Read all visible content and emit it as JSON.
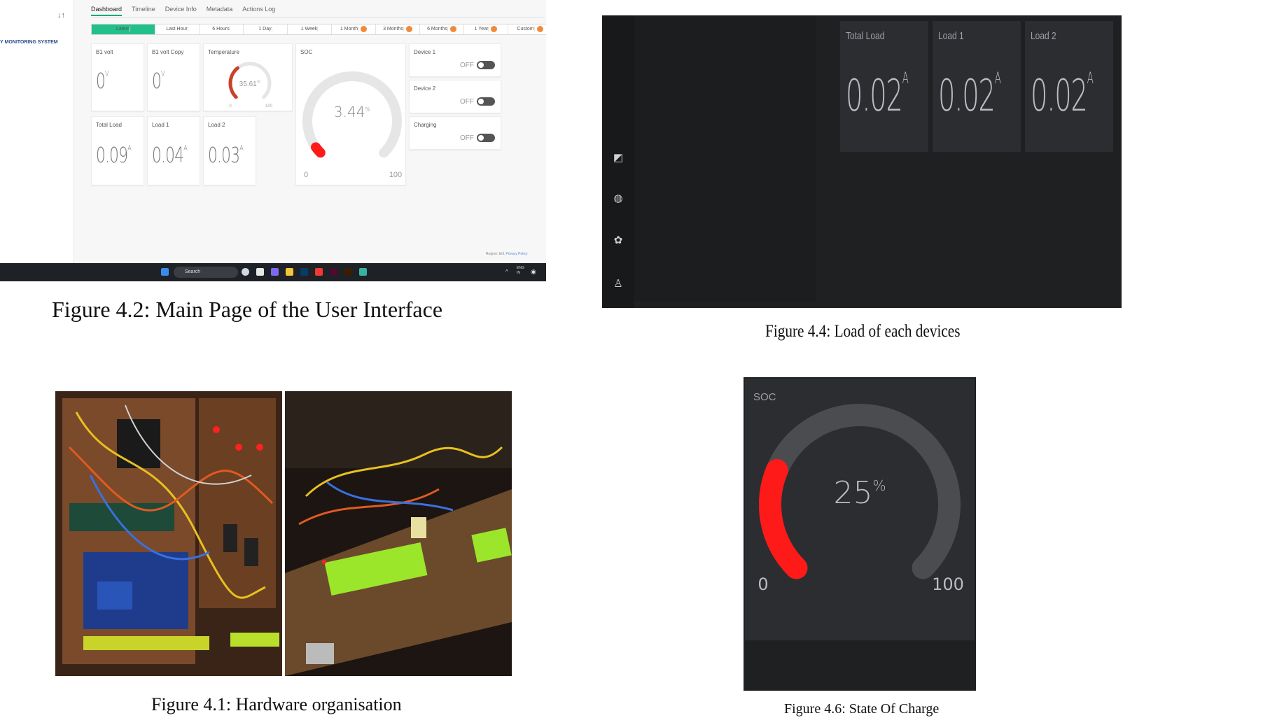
{
  "fig42": {
    "brand": "Y MONITORING SYSTEM",
    "tabs": [
      "Dashboard",
      "Timeline",
      "Device Info",
      "Metadata",
      "Actions Log"
    ],
    "ranges": [
      "Latest",
      "Last Hour",
      "6 Hours",
      "1 Day",
      "1 Week",
      "1 Month",
      "3 Months",
      "6 Months",
      "1 Year",
      "Custom"
    ],
    "widgets": {
      "b1volt": {
        "title": "B1 volt",
        "value": "0",
        "unit": "V"
      },
      "b1copy": {
        "title": "B1 volt Copy",
        "value": "0",
        "unit": "V"
      },
      "temperature": {
        "title": "Temperature",
        "value": "35.61",
        "unit": "°C",
        "min": "0",
        "max": "100",
        "level": 0.3561
      },
      "soc": {
        "title": "SOC",
        "value": "3.44",
        "unit": "%",
        "min": "0",
        "max": "100",
        "level": 0.0344
      },
      "device1": {
        "title": "Device 1",
        "state": "OFF"
      },
      "device2": {
        "title": "Device 2",
        "state": "OFF"
      },
      "charging": {
        "title": "Charging",
        "state": "OFF"
      },
      "totalload": {
        "title": "Total Load",
        "value": "0.09",
        "unit": "A"
      },
      "load1": {
        "title": "Load 1",
        "value": "0.04",
        "unit": "A"
      },
      "load2": {
        "title": "Load 2",
        "value": "0.03",
        "unit": "A"
      }
    },
    "taskbar_search": "Search",
    "lang": "ENG\nIN",
    "region": "Region: blr1",
    "privacy": "Privacy Policy",
    "caption": "Figure 4.2: Main Page of the User Interface"
  },
  "fig44": {
    "cards": [
      {
        "title": "Total Load",
        "value": "0.02",
        "unit": "A"
      },
      {
        "title": "Load 1",
        "value": "0.02",
        "unit": "A"
      },
      {
        "title": "Load 2",
        "value": "0.02",
        "unit": "A"
      }
    ],
    "caption": "Figure 4.4: Load of each devices"
  },
  "fig41": {
    "caption": "Figure 4.1: Hardware organisation"
  },
  "fig46": {
    "title": "SOC",
    "value": "25",
    "unit": "%",
    "min": "0",
    "max": "100",
    "level": 0.25,
    "caption": "Figure 4.6: State Of Charge"
  },
  "colors": {
    "accent_green": "#21c08b",
    "gauge_red": "#ff1a1a",
    "temp_red": "#c9402b",
    "range_badge": "#f08a3b"
  }
}
